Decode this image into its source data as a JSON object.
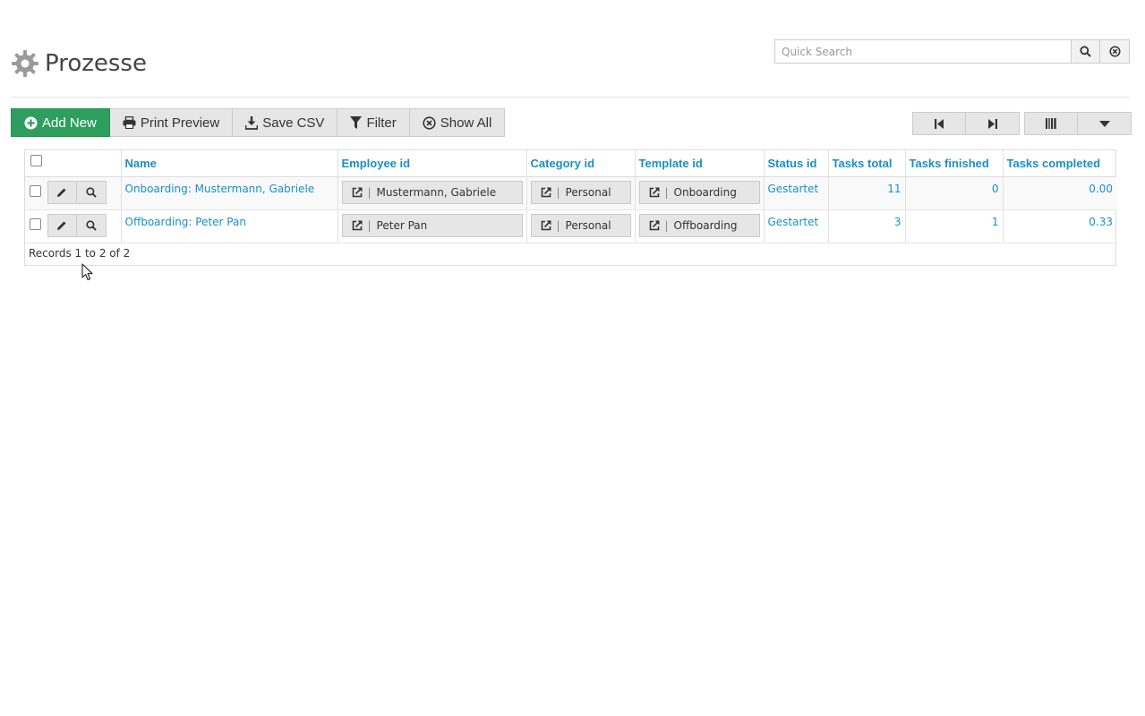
{
  "page": {
    "title": "Prozesse",
    "icon": "gear-icon"
  },
  "search": {
    "placeholder": "Quick Search",
    "value": "",
    "search_icon": "search-icon",
    "clear_icon": "clear-circle-icon"
  },
  "toolbar": {
    "add_new": "Add New",
    "print_preview": "Print Preview",
    "save_csv": "Save CSV",
    "filter": "Filter",
    "show_all": "Show All",
    "accent": "#2e9e5e"
  },
  "pager": {
    "first_icon": "first-page-icon",
    "last_icon": "last-page-icon",
    "columns_icon": "columns-icon",
    "menu_icon": "caret-down-icon"
  },
  "table": {
    "columns": [
      "Name",
      "Employee id",
      "Category id",
      "Template id",
      "Status id",
      "Tasks total",
      "Tasks finished",
      "Tasks completed"
    ],
    "rows": [
      {
        "name": "Onboarding: Mustermann, Gabriele",
        "employee": "Mustermann, Gabriele",
        "category": "Personal",
        "template": "Onboarding",
        "status": "Gestartet",
        "tasks_total": "11",
        "tasks_finished": "0",
        "tasks_completed": "0.00"
      },
      {
        "name": "Offboarding: Peter Pan",
        "employee": "Peter Pan",
        "category": "Personal",
        "template": "Offboarding",
        "status": "Gestartet",
        "tasks_total": "3",
        "tasks_finished": "1",
        "tasks_completed": "0.33"
      }
    ],
    "footer": "Records 1 to 2 of 2",
    "link_color": "#1a8fc9"
  }
}
